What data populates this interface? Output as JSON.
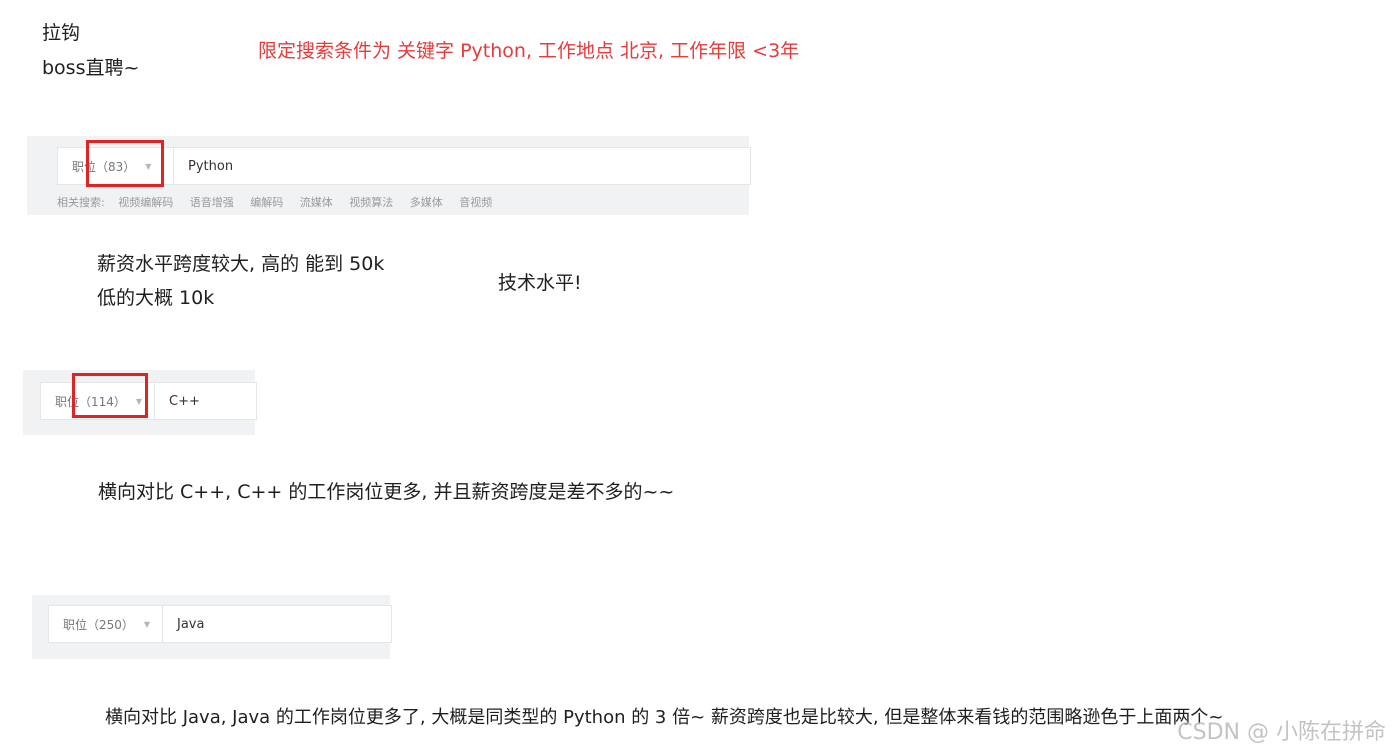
{
  "notes": {
    "line1": "拉钩",
    "line2": "boss直聘~",
    "search_condition": "限定搜索条件为 关键字 Python, 工作地点 北京, 工作年限 <3年",
    "salary_line1": "薪资水平跨度较大, 高的 能到 50k",
    "salary_line2": "低的大概 10k",
    "tech_level": "技术水平!",
    "cpp_compare": "横向对比 C++, C++ 的工作岗位更多, 并且薪资跨度是差不多的~~",
    "java_compare": "横向对比 Java, Java 的工作岗位更多了, 大概是同类型的 Python 的 3 倍~ 薪资跨度也是比较大, 但是整体来看钱的范围略逊色于上面两个~"
  },
  "search_python": {
    "dropdown_label": "职位（83）",
    "keyword": "Python",
    "related_label": "相关搜索:",
    "related_items": [
      "视频编解码",
      "语音增强",
      "编解码",
      "流媒体",
      "视频算法",
      "多媒体",
      "音视频"
    ]
  },
  "search_cpp": {
    "dropdown_label": "职位（114）",
    "keyword": "C++"
  },
  "search_java": {
    "dropdown_label": "职位（250）",
    "keyword": "Java"
  },
  "watermark": "CSDN @ 小陈在拼命",
  "colors": {
    "annotation_red": "#e02424",
    "note_red": "#e63b3b"
  }
}
